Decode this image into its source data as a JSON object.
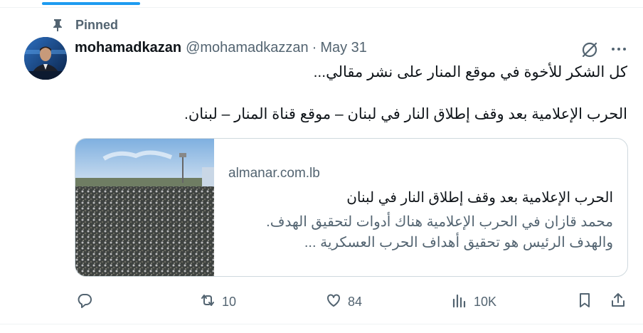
{
  "pinned_label": "Pinned",
  "tweet": {
    "display_name": "mohamadkazan",
    "handle": "@mohamadkazzan",
    "separator": "·",
    "date": "May 31",
    "text_lines": [
      "كل الشكر للأخوة في موقع المنار على نشر مقالي...",
      "الحرب الإعلامية بعد وقف إطلاق النار في لبنان – موقع قناة المنار – لبنان."
    ],
    "card": {
      "domain": "almanar.com.lb",
      "title": "الحرب الإعلامية بعد وقف إطلاق النار في لبنان",
      "description_lines": [
        "محمد قازان في الحرب الإعلامية هناك أدوات لتحقيق الهدف.",
        "والهدف الرئيس هو تحقيق أهداف الحرب العسكرية ..."
      ]
    },
    "stats": {
      "reposts": "10",
      "likes": "84",
      "views": "10K"
    }
  },
  "colors": {
    "accent": "#1d9bf0",
    "text": "#0f1419",
    "secondary": "#536471",
    "border": "#cfd9de"
  },
  "icons": [
    "pin-icon",
    "grok-icon",
    "more-icon",
    "reply-icon",
    "repost-icon",
    "like-icon",
    "views-icon",
    "bookmark-icon",
    "share-icon"
  ]
}
